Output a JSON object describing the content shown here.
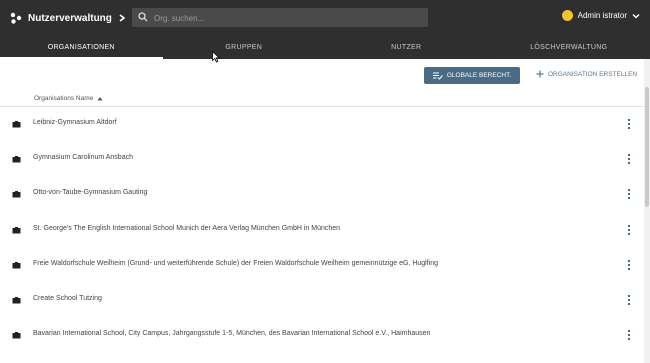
{
  "app": {
    "title": "Nutzerverwaltung"
  },
  "search": {
    "placeholder": "Org. suchen..."
  },
  "user": {
    "name": "Admin istrator"
  },
  "tabs": [
    {
      "label": "ORGANISATIONEN",
      "active": true
    },
    {
      "label": "GRUPPEN",
      "active": false
    },
    {
      "label": "NUTZER",
      "active": false
    },
    {
      "label": "LÖSCHVERWALTUNG",
      "active": false
    }
  ],
  "actions": {
    "global_rights": "GLOBALE BERECHT.",
    "create_org": "ORGANISATION ERSTELLEN"
  },
  "table": {
    "column_header": "Organisations Name",
    "rows": [
      "Leibniz-Gymnasium Altdorf",
      "Gymnasium Carolinum Ansbach",
      "Otto-von-Taube-Gymnasium Gauting",
      "St. George's The English International School Munich der Aera Verlag München GmbH in München",
      "Freie Waldorfschule Weilheim (Grund- und weiterführende Schule) der Freien Waldorfschule Weilheim gemeinnützige eG, Huglfing",
      "Create School Tutzing",
      "Bavarian International School, City Campus, Jahrgangsstufe 1-5, München, des Bavarian International School e.V., Haimhausen"
    ]
  },
  "colors": {
    "topbar": "#2f2f2f",
    "accent_button": "#4a6b85",
    "link": "#5a7890"
  }
}
